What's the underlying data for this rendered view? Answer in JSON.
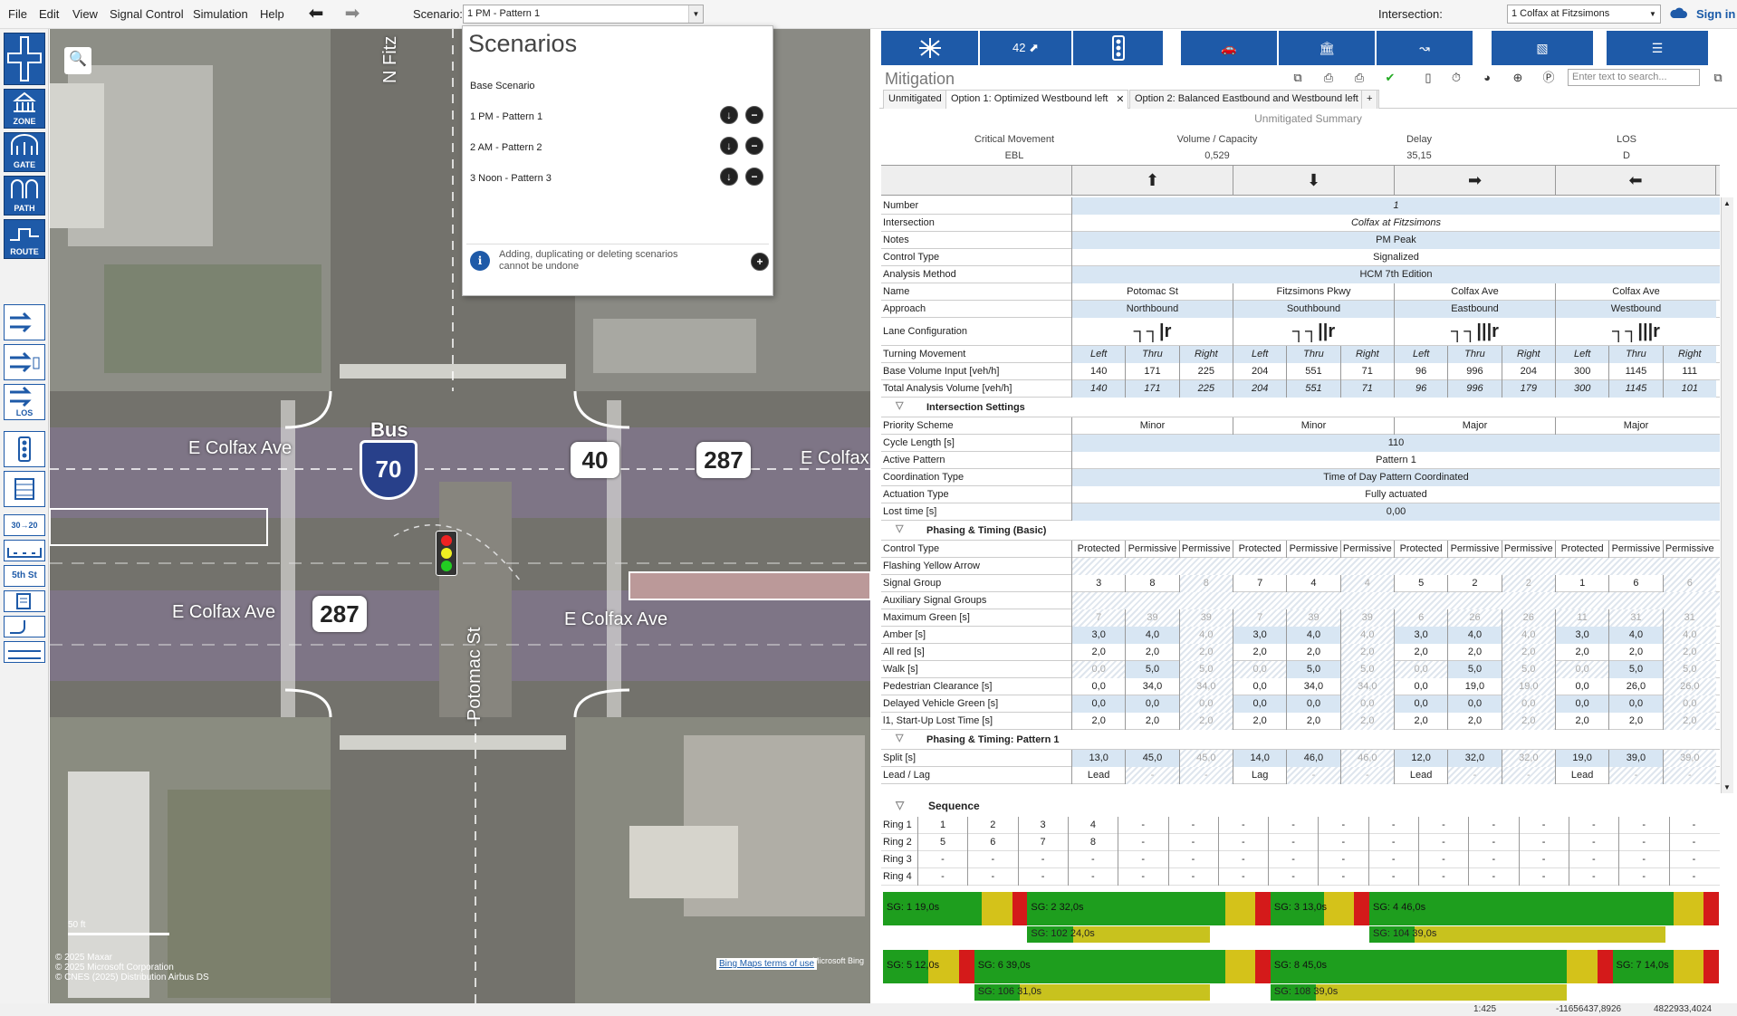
{
  "menu": {
    "file": "File",
    "edit": "Edit",
    "view": "View",
    "signal_control": "Signal Control",
    "simulation": "Simulation",
    "help": "Help"
  },
  "scenario": {
    "label": "Scenario:",
    "selected": "1 PM - Pattern 1"
  },
  "intersection": {
    "label": "Intersection:",
    "selected": "1 Colfax at Fitzsimons"
  },
  "signin": "Sign in",
  "left_tools": {
    "zone": "ZONE",
    "gate": "GATE",
    "path": "PATH",
    "route": "ROUTE",
    "los": "LOS",
    "sign_30_20": "30→20",
    "street_5th": "5th St"
  },
  "map": {
    "street_colfax_left": "E Colfax Ave",
    "street_colfax_left2": "E Colfax Ave",
    "street_colfax_right": "E Colfax Ave",
    "street_colfax_top_right": "E Colfax",
    "street_fitz": "N Fitz",
    "street_potomac": "Potomac St",
    "bus_label": "Bus",
    "shield_70": "70",
    "shield_40": "40",
    "shield_287a": "287",
    "shield_287b": "287",
    "scale": "50 ft",
    "rights": [
      "© 2025 Maxar",
      "© 2025 Microsoft Corporation",
      "© CNES (2025) Distribution Airbus DS"
    ],
    "bing_terms": "Bing Maps terms of use",
    "ms_bing": "Microsoft Bing"
  },
  "scenarios_panel": {
    "title": "Scenarios",
    "base": "Base Scenario",
    "items": [
      "1 PM - Pattern 1",
      "2  AM - Pattern 2",
      "3 Noon - Pattern 3"
    ],
    "note": "Adding, duplicating or deleting scenarios cannot be undone"
  },
  "right_tools": {
    "badge_42": "42"
  },
  "mitigation": {
    "title": "Mitigation",
    "search_placeholder": "Enter text to search..."
  },
  "tabs": [
    "Unmitigated",
    "Option 1: Optimized Westbound left",
    "Option 2: Balanced Eastbound and Westbound left",
    "+"
  ],
  "summary": {
    "title": "Unmitigated Summary",
    "headers": [
      "Critical Movement",
      "Volume / Capacity",
      "Delay",
      "LOS"
    ],
    "values": [
      "EBL",
      "0,529",
      "35,15",
      "D"
    ]
  },
  "directions": [
    "⬆",
    "⬇",
    "➡",
    "⬅"
  ],
  "grid": {
    "number": {
      "label": "Number",
      "value": "1"
    },
    "intersection": {
      "label": "Intersection",
      "value": "Colfax at Fitzsimons"
    },
    "notes": {
      "label": "Notes",
      "value": "PM Peak"
    },
    "control_type": {
      "label": "Control Type",
      "value": "Signalized"
    },
    "analysis_method": {
      "label": "Analysis Method",
      "value": "HCM 7th Edition"
    },
    "name": {
      "label": "Name",
      "values": [
        "Potomac St",
        "Fitzsimons Pkwy",
        "Colfax Ave",
        "Colfax Ave"
      ]
    },
    "approach": {
      "label": "Approach",
      "values": [
        "Northbound",
        "Southbound",
        "Eastbound",
        "Westbound"
      ]
    },
    "lane_config": {
      "label": "Lane Configuration",
      "values": [
        "┐┐|r",
        "┐┐||r",
        "┐┐|||r",
        "┐┐|||r"
      ]
    },
    "turning": {
      "label": "Turning Movement",
      "values": [
        "Left",
        "Thru",
        "Right",
        "Left",
        "Thru",
        "Right",
        "Left",
        "Thru",
        "Right",
        "Left",
        "Thru",
        "Right"
      ]
    },
    "base_volume": {
      "label": "Base Volume Input [veh/h]",
      "values": [
        "140",
        "171",
        "225",
        "204",
        "551",
        "71",
        "96",
        "996",
        "204",
        "300",
        "1145",
        "111"
      ]
    },
    "total_volume": {
      "label": "Total Analysis Volume [veh/h]",
      "values": [
        "140",
        "171",
        "225",
        "204",
        "551",
        "71",
        "96",
        "996",
        "179",
        "300",
        "1145",
        "101"
      ]
    },
    "sect_intersection": "Intersection Settings",
    "priority": {
      "label": "Priority Scheme",
      "values": [
        "Minor",
        "Minor",
        "Major",
        "Major"
      ]
    },
    "cycle": {
      "label": "Cycle Length [s]",
      "value": "110"
    },
    "active_pattern": {
      "label": "Active Pattern",
      "value": "Pattern 1"
    },
    "coordination": {
      "label": "Coordination Type",
      "value": "Time of Day Pattern Coordinated"
    },
    "actuation": {
      "label": "Actuation Type",
      "value": "Fully actuated"
    },
    "lost_time": {
      "label": "Lost time [s]",
      "value": "0,00"
    },
    "sect_basic": "Phasing & Timing (Basic)",
    "phase_control": {
      "label": "Control Type",
      "values": [
        "Protected",
        "Permissive",
        "Permissive",
        "Protected",
        "Permissive",
        "Permissive",
        "Protected",
        "Permissive",
        "Permissive",
        "Protected",
        "Permissive",
        "Permissive"
      ]
    },
    "flashing": {
      "label": "Flashing Yellow Arrow"
    },
    "signal_group": {
      "label": "Signal Group",
      "values": [
        "3",
        "8",
        "8",
        "7",
        "4",
        "4",
        "5",
        "2",
        "2",
        "1",
        "6",
        "6"
      ]
    },
    "aux": {
      "label": "Auxiliary Signal Groups"
    },
    "max_green": {
      "label": "Maximum Green [s]",
      "values": [
        "7",
        "39",
        "39",
        "7",
        "39",
        "39",
        "6",
        "26",
        "26",
        "11",
        "31",
        "31"
      ]
    },
    "amber": {
      "label": "Amber [s]",
      "values": [
        "3,0",
        "4,0",
        "4,0",
        "3,0",
        "4,0",
        "4,0",
        "3,0",
        "4,0",
        "4,0",
        "3,0",
        "4,0",
        "4,0"
      ]
    },
    "allred": {
      "label": "All red [s]",
      "values": [
        "2,0",
        "2,0",
        "2,0",
        "2,0",
        "2,0",
        "2,0",
        "2,0",
        "2,0",
        "2,0",
        "2,0",
        "2,0",
        "2,0"
      ]
    },
    "walk": {
      "label": "Walk [s]",
      "values": [
        "0,0",
        "5,0",
        "5,0",
        "0,0",
        "5,0",
        "5,0",
        "0,0",
        "5,0",
        "5,0",
        "0,0",
        "5,0",
        "5,0"
      ]
    },
    "ped_clear": {
      "label": "Pedestrian Clearance [s]",
      "values": [
        "0,0",
        "34,0",
        "34,0",
        "0,0",
        "34,0",
        "34,0",
        "0,0",
        "19,0",
        "19,0",
        "0,0",
        "26,0",
        "26,0"
      ]
    },
    "delayed": {
      "label": "Delayed Vehicle Green [s]",
      "values": [
        "0,0",
        "0,0",
        "0,0",
        "0,0",
        "0,0",
        "0,0",
        "0,0",
        "0,0",
        "0,0",
        "0,0",
        "0,0",
        "0,0"
      ]
    },
    "startup": {
      "label": "l1, Start-Up Lost Time [s]",
      "values": [
        "2,0",
        "2,0",
        "2,0",
        "2,0",
        "2,0",
        "2,0",
        "2,0",
        "2,0",
        "2,0",
        "2,0",
        "2,0",
        "2,0"
      ]
    },
    "sect_pattern": "Phasing & Timing: Pattern 1",
    "split": {
      "label": "Split [s]",
      "values": [
        "13,0",
        "45,0",
        "45,0",
        "14,0",
        "46,0",
        "46,0",
        "12,0",
        "32,0",
        "32,0",
        "19,0",
        "39,0",
        "39,0"
      ]
    },
    "leadlag": {
      "label": "Lead / Lag",
      "values": [
        "Lead",
        "-",
        "-",
        "Lag",
        "-",
        "-",
        "Lead",
        "-",
        "-",
        "Lead",
        "-",
        "-"
      ]
    }
  },
  "sequence": {
    "title": "Sequence",
    "rings": [
      {
        "label": "Ring 1",
        "values": [
          "1",
          "2",
          "3",
          "4",
          "-",
          "-",
          "-",
          "-",
          "-",
          "-",
          "-",
          "-",
          "-",
          "-",
          "-",
          "-"
        ]
      },
      {
        "label": "Ring 2",
        "values": [
          "5",
          "6",
          "7",
          "8",
          "-",
          "-",
          "-",
          "-",
          "-",
          "-",
          "-",
          "-",
          "-",
          "-",
          "-",
          "-"
        ]
      },
      {
        "label": "Ring 3",
        "values": [
          "-",
          "-",
          "-",
          "-",
          "-",
          "-",
          "-",
          "-",
          "-",
          "-",
          "-",
          "-",
          "-",
          "-",
          "-",
          "-"
        ]
      },
      {
        "label": "Ring 4",
        "values": [
          "-",
          "-",
          "-",
          "-",
          "-",
          "-",
          "-",
          "-",
          "-",
          "-",
          "-",
          "-",
          "-",
          "-",
          "-",
          "-"
        ]
      }
    ]
  },
  "signal_bars": {
    "ring1": [
      {
        "label": "SG: 1  19,0s",
        "split": 19
      },
      {
        "label": "SG: 2  32,0s",
        "split": 32
      },
      {
        "label": "SG: 3  13,0s",
        "split": 13
      },
      {
        "label": "SG: 4  46,0s",
        "split": 46
      }
    ],
    "ring1_sub": [
      {
        "label": "SG: 102  24,0s",
        "split": 24
      },
      {
        "label": "SG: 104  39,0s",
        "split": 39
      }
    ],
    "ring2": [
      {
        "label": "SG: 5  12,0s",
        "split": 12
      },
      {
        "label": "SG: 6  39,0s",
        "split": 39
      },
      {
        "label": "SG: 8  45,0s",
        "split": 45
      },
      {
        "label": "SG: 7  14,0s",
        "split": 14
      }
    ],
    "ring2_sub": [
      {
        "label": "SG: 106  31,0s",
        "split": 31
      },
      {
        "label": "SG: 108  39,0s",
        "split": 39
      }
    ],
    "colors": {
      "green": "#1e9e1e",
      "yellow": "#d4c21a",
      "red": "#d41a1a",
      "sub_yellow": "#c8c21e"
    }
  },
  "status": {
    "scale": "1:425",
    "x": "-11656437,8926",
    "y": "4822933,4024"
  }
}
